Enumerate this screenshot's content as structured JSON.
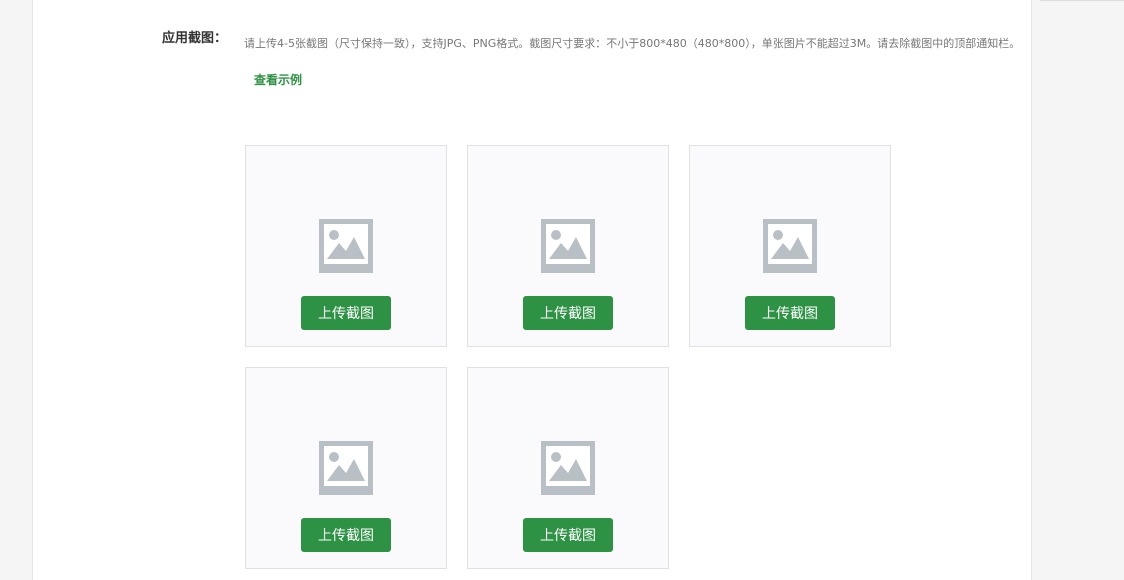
{
  "form": {
    "label": "应用截图：",
    "description": "请上传4-5张截图（尺寸保持一致），支持JPG、PNG格式。截图尺寸要求：不小于800*480（480*800），单张图片不能超过3M。请去除截图中的顶部通知栏。",
    "example_link": "查看示例"
  },
  "slots": [
    {
      "button_label": "上传截图",
      "icon": "image-placeholder-icon"
    },
    {
      "button_label": "上传截图",
      "icon": "image-placeholder-icon"
    },
    {
      "button_label": "上传截图",
      "icon": "image-placeholder-icon"
    },
    {
      "button_label": "上传截图",
      "icon": "image-placeholder-icon"
    },
    {
      "button_label": "上传截图",
      "icon": "image-placeholder-icon"
    }
  ],
  "colors": {
    "accent": "#2e9245",
    "placeholder_icon": "#b8c0c6",
    "slot_bg": "#fafafc"
  }
}
